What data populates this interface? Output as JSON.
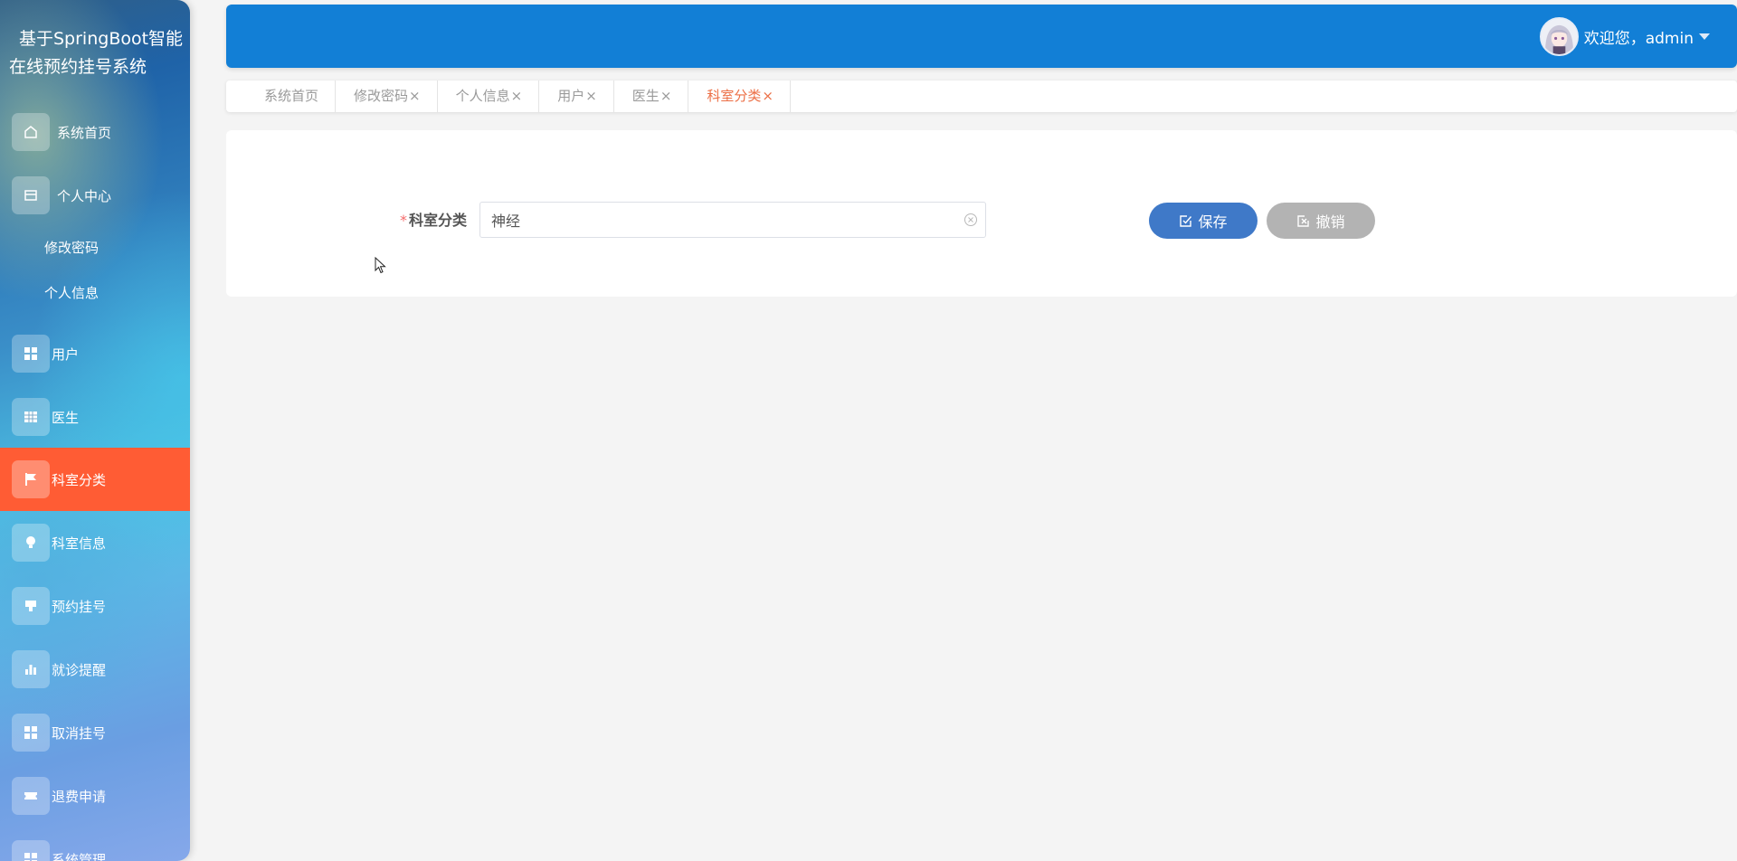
{
  "sidebar": {
    "title": "基于SpringBoot智能在线预约挂号系统",
    "items": [
      {
        "label": "系统首页",
        "icon": "home-icon"
      },
      {
        "label": "个人中心",
        "icon": "id-card-icon"
      },
      {
        "label": "用户",
        "icon": "grid-icon"
      },
      {
        "label": "医生",
        "icon": "table-icon"
      },
      {
        "label": "科室分类",
        "icon": "flag-icon",
        "active": true
      },
      {
        "label": "科室信息",
        "icon": "lightbulb-icon"
      },
      {
        "label": "预约挂号",
        "icon": "stamp-icon"
      },
      {
        "label": "就诊提醒",
        "icon": "bar-chart-icon"
      },
      {
        "label": "取消挂号",
        "icon": "grid-icon"
      },
      {
        "label": "退费申请",
        "icon": "ticket-icon"
      },
      {
        "label": "系统管理",
        "icon": "grid-icon"
      }
    ],
    "sub_items": [
      "修改密码",
      "个人信息"
    ]
  },
  "header": {
    "welcome": "欢迎您，admin"
  },
  "tabs": [
    {
      "label": "系统首页",
      "closable": false
    },
    {
      "label": "修改密码",
      "closable": true
    },
    {
      "label": "个人信息",
      "closable": true
    },
    {
      "label": "用户",
      "closable": true
    },
    {
      "label": "医生",
      "closable": true
    },
    {
      "label": "科室分类",
      "closable": true,
      "active": true
    }
  ],
  "tab_close_symbol": "×",
  "form": {
    "label": "科室分类",
    "required_mark": "*",
    "value": "神经",
    "save_label": "保存",
    "cancel_label": "撤销"
  },
  "colors": {
    "header": "#127fd6",
    "active_menu": "#ff5c34",
    "active_tab": "#ec6f46",
    "save_button": "#3f79c8",
    "cancel_button": "#b3b3b3"
  }
}
